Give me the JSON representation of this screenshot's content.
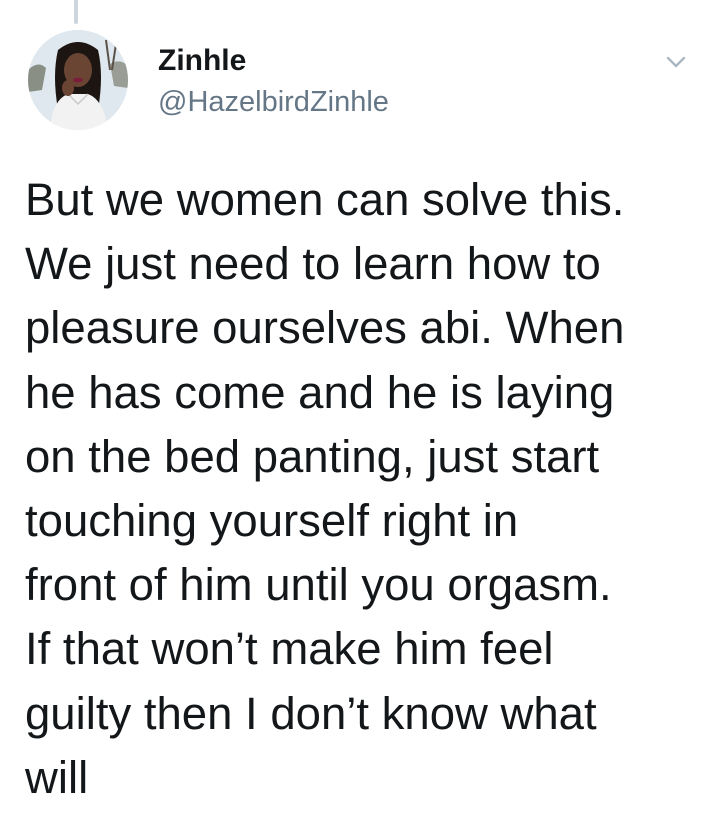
{
  "tweet": {
    "author": {
      "display_name": "Zinhle",
      "handle": "@HazelbirdZinhle",
      "avatar_icon": "profile-photo"
    },
    "menu_icon": "chevron-down-icon",
    "text": "But we women can solve this.\nWe just need to learn how to\npleasure ourselves abi. When\nhe has come and he is laying\non the bed panting, just start\ntouching yourself right in\nfront of him until you orgasm.\nIf that won’t make him feel\nguilty then I don’t know what\nwill"
  },
  "colors": {
    "text_primary": "#14171a",
    "text_secondary": "#657786",
    "thread_line": "#ccd6dd",
    "background": "#ffffff"
  }
}
